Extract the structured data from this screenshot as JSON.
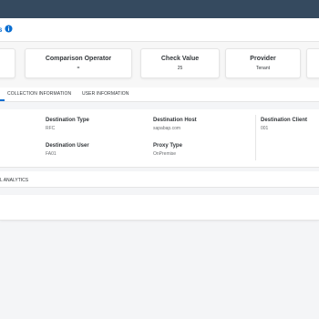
{
  "header": {
    "title": "s",
    "info_icon": "info-circle-icon"
  },
  "cards": [
    {
      "label": "Comparison Operator",
      "value": "="
    },
    {
      "label": "Check Value",
      "value": "25"
    },
    {
      "label": "Provider",
      "value": "Tenant"
    }
  ],
  "tabs": [
    {
      "label": "COLLECTION INFORMATION"
    },
    {
      "label": "USER INFORMATION"
    }
  ],
  "details": {
    "destination_type": {
      "label": "Destination Type",
      "value": "RFC"
    },
    "destination_host": {
      "label": "Destination Host",
      "value": "sapabap.com"
    },
    "destination_client": {
      "label": "Destination Client",
      "value": "001"
    },
    "destination_user": {
      "label": "Destination User",
      "value": "FA01"
    },
    "proxy_type": {
      "label": "Proxy Type",
      "value": "OnPremise"
    }
  },
  "section": {
    "label": "L ANALYTICS"
  },
  "colors": {
    "shell": "#354a5f",
    "accent": "#0a6ed1"
  }
}
